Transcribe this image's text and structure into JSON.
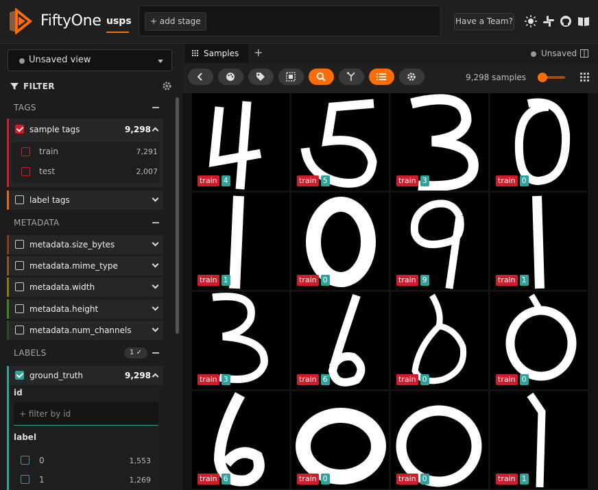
{
  "header": {
    "brand": "FiftyOne",
    "dataset": "usps",
    "add_stage": "+ add stage",
    "team_button": "Have a Team?",
    "icons": [
      "theme-icon",
      "slack-icon",
      "github-icon",
      "docs-icon"
    ]
  },
  "sidebar": {
    "view_select": "Unsaved view",
    "filter_heading": "FILTER",
    "tags_heading": "TAGS",
    "sample_tags": {
      "label": "sample tags",
      "count": "9,298",
      "items": [
        {
          "label": "train",
          "count": "7,291"
        },
        {
          "label": "test",
          "count": "2,007"
        }
      ]
    },
    "label_tags": {
      "label": "label tags"
    },
    "metadata_heading": "METADATA",
    "metadata_fields": [
      "metadata.size_bytes",
      "metadata.mime_type",
      "metadata.width",
      "metadata.height",
      "metadata.num_channels"
    ],
    "labels_heading": "LABELS",
    "labels_badge": "1 ✓",
    "ground_truth": {
      "label": "ground_truth",
      "count": "9,298"
    },
    "id_label": "id",
    "id_placeholder": "+ filter by id",
    "label_label": "label",
    "label_values": [
      {
        "label": "0",
        "count": "1,553"
      },
      {
        "label": "1",
        "count": "1,269"
      }
    ]
  },
  "main": {
    "tab_label": "Samples",
    "tab_add": "+",
    "unsaved": "Unsaved",
    "samples_count": "9,298 samples",
    "colors": {
      "accent": "#ff6d04",
      "train_tag": "#d11c2c",
      "label_tag": "#2ea39c"
    },
    "samples": [
      {
        "tag": "train",
        "label": "4"
      },
      {
        "tag": "train",
        "label": "5"
      },
      {
        "tag": "train",
        "label": "3"
      },
      {
        "tag": "train",
        "label": "0"
      },
      {
        "tag": "train",
        "label": "1"
      },
      {
        "tag": "train",
        "label": "0"
      },
      {
        "tag": "train",
        "label": "9"
      },
      {
        "tag": "train",
        "label": "1"
      },
      {
        "tag": "train",
        "label": "3"
      },
      {
        "tag": "train",
        "label": "6"
      },
      {
        "tag": "train",
        "label": "0"
      },
      {
        "tag": "train",
        "label": "0"
      },
      {
        "tag": "train",
        "label": "6"
      },
      {
        "tag": "train",
        "label": "0"
      },
      {
        "tag": "train",
        "label": "0"
      },
      {
        "tag": "train",
        "label": "1"
      }
    ]
  }
}
